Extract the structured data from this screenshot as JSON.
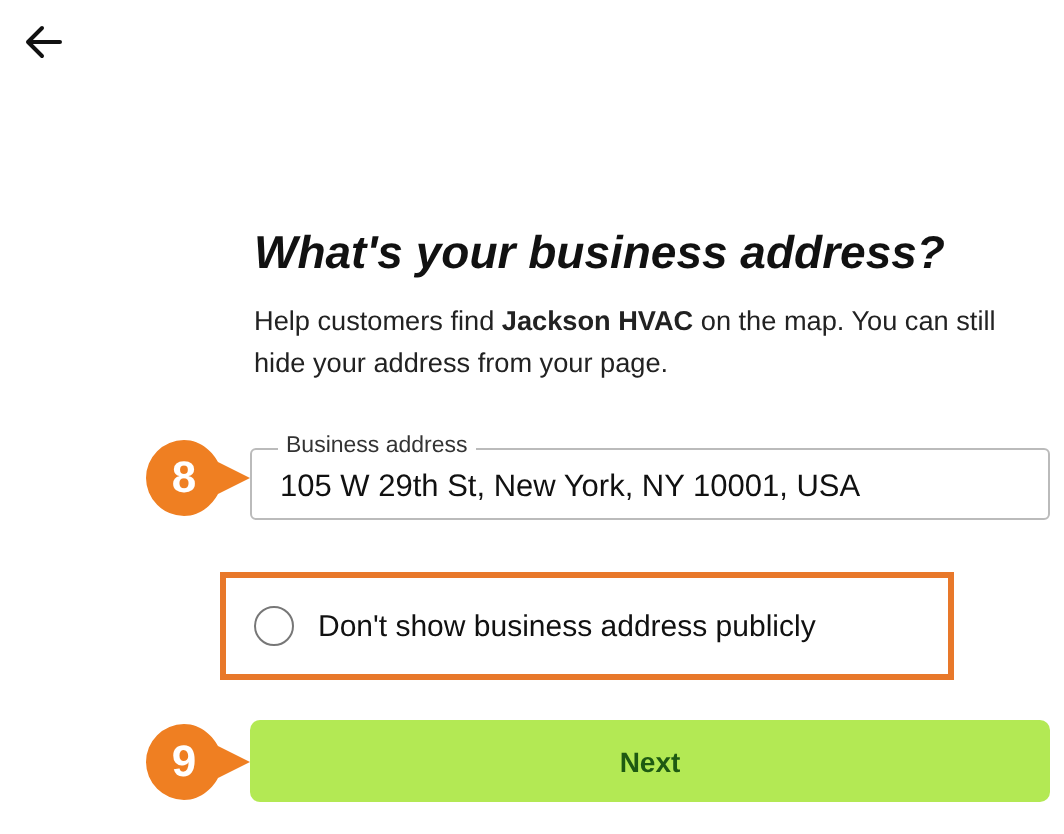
{
  "heading": "What's your business address?",
  "description": "Help customers find **Jackson HVAC** on the map. You can still hide your address from your page.",
  "address_field": {
    "label": "Business address",
    "value": "105 W 29th St, New York, NY 10001, USA",
    "step": "8"
  },
  "hide_address": {
    "label": "Don't show business address publicly",
    "checked": false,
    "highlighted": true
  },
  "next_button": {
    "label": "Next",
    "step": "9"
  }
}
